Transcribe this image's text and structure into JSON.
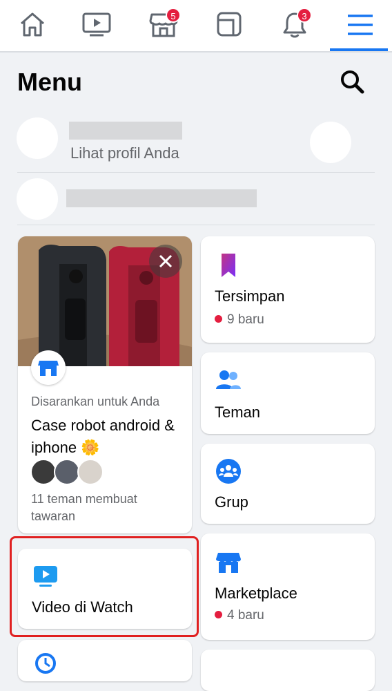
{
  "nav": {
    "items": [
      {
        "icon": "home-icon"
      },
      {
        "icon": "watch-icon"
      },
      {
        "icon": "marketplace-icon",
        "badge": "5"
      },
      {
        "icon": "feeds-icon"
      },
      {
        "icon": "bell-icon",
        "badge": "3"
      },
      {
        "icon": "menu-icon",
        "active": true
      }
    ]
  },
  "header": {
    "title": "Menu"
  },
  "profile": {
    "subtitle": "Lihat profil Anda"
  },
  "marketplace_suggestion": {
    "suggested_label": "Disarankan untuk Anda",
    "title": "Case robot android & iphone 🌼",
    "friends_text": "11 teman membuat tawaran"
  },
  "shortcuts": {
    "saved": {
      "label": "Tersimpan",
      "sub": "9 baru"
    },
    "friends": {
      "label": "Teman"
    },
    "groups": {
      "label": "Grup"
    },
    "marketplace": {
      "label": "Marketplace",
      "sub": "4 baru"
    },
    "watch": {
      "label": "Video di Watch"
    }
  },
  "colors": {
    "accent": "#1877f2",
    "badge": "#e41e3f",
    "highlight": "#e02020"
  }
}
